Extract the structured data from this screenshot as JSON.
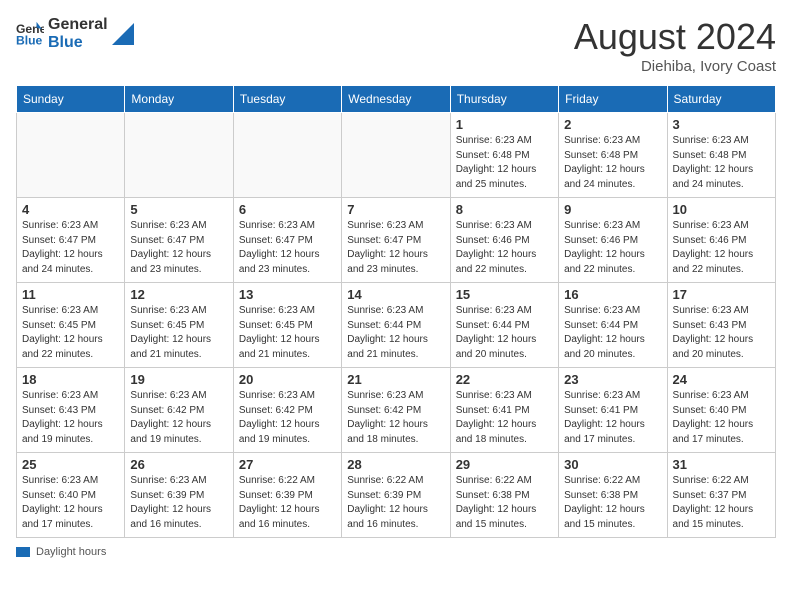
{
  "header": {
    "logo_line1": "General",
    "logo_line2": "Blue",
    "month": "August 2024",
    "location": "Diehiba, Ivory Coast"
  },
  "days_of_week": [
    "Sunday",
    "Monday",
    "Tuesday",
    "Wednesday",
    "Thursday",
    "Friday",
    "Saturday"
  ],
  "weeks": [
    [
      {
        "day": "",
        "info": ""
      },
      {
        "day": "",
        "info": ""
      },
      {
        "day": "",
        "info": ""
      },
      {
        "day": "",
        "info": ""
      },
      {
        "day": "1",
        "info": "Sunrise: 6:23 AM\nSunset: 6:48 PM\nDaylight: 12 hours\nand 25 minutes."
      },
      {
        "day": "2",
        "info": "Sunrise: 6:23 AM\nSunset: 6:48 PM\nDaylight: 12 hours\nand 24 minutes."
      },
      {
        "day": "3",
        "info": "Sunrise: 6:23 AM\nSunset: 6:48 PM\nDaylight: 12 hours\nand 24 minutes."
      }
    ],
    [
      {
        "day": "4",
        "info": "Sunrise: 6:23 AM\nSunset: 6:47 PM\nDaylight: 12 hours\nand 24 minutes."
      },
      {
        "day": "5",
        "info": "Sunrise: 6:23 AM\nSunset: 6:47 PM\nDaylight: 12 hours\nand 23 minutes."
      },
      {
        "day": "6",
        "info": "Sunrise: 6:23 AM\nSunset: 6:47 PM\nDaylight: 12 hours\nand 23 minutes."
      },
      {
        "day": "7",
        "info": "Sunrise: 6:23 AM\nSunset: 6:47 PM\nDaylight: 12 hours\nand 23 minutes."
      },
      {
        "day": "8",
        "info": "Sunrise: 6:23 AM\nSunset: 6:46 PM\nDaylight: 12 hours\nand 22 minutes."
      },
      {
        "day": "9",
        "info": "Sunrise: 6:23 AM\nSunset: 6:46 PM\nDaylight: 12 hours\nand 22 minutes."
      },
      {
        "day": "10",
        "info": "Sunrise: 6:23 AM\nSunset: 6:46 PM\nDaylight: 12 hours\nand 22 minutes."
      }
    ],
    [
      {
        "day": "11",
        "info": "Sunrise: 6:23 AM\nSunset: 6:45 PM\nDaylight: 12 hours\nand 22 minutes."
      },
      {
        "day": "12",
        "info": "Sunrise: 6:23 AM\nSunset: 6:45 PM\nDaylight: 12 hours\nand 21 minutes."
      },
      {
        "day": "13",
        "info": "Sunrise: 6:23 AM\nSunset: 6:45 PM\nDaylight: 12 hours\nand 21 minutes."
      },
      {
        "day": "14",
        "info": "Sunrise: 6:23 AM\nSunset: 6:44 PM\nDaylight: 12 hours\nand 21 minutes."
      },
      {
        "day": "15",
        "info": "Sunrise: 6:23 AM\nSunset: 6:44 PM\nDaylight: 12 hours\nand 20 minutes."
      },
      {
        "day": "16",
        "info": "Sunrise: 6:23 AM\nSunset: 6:44 PM\nDaylight: 12 hours\nand 20 minutes."
      },
      {
        "day": "17",
        "info": "Sunrise: 6:23 AM\nSunset: 6:43 PM\nDaylight: 12 hours\nand 20 minutes."
      }
    ],
    [
      {
        "day": "18",
        "info": "Sunrise: 6:23 AM\nSunset: 6:43 PM\nDaylight: 12 hours\nand 19 minutes."
      },
      {
        "day": "19",
        "info": "Sunrise: 6:23 AM\nSunset: 6:42 PM\nDaylight: 12 hours\nand 19 minutes."
      },
      {
        "day": "20",
        "info": "Sunrise: 6:23 AM\nSunset: 6:42 PM\nDaylight: 12 hours\nand 19 minutes."
      },
      {
        "day": "21",
        "info": "Sunrise: 6:23 AM\nSunset: 6:42 PM\nDaylight: 12 hours\nand 18 minutes."
      },
      {
        "day": "22",
        "info": "Sunrise: 6:23 AM\nSunset: 6:41 PM\nDaylight: 12 hours\nand 18 minutes."
      },
      {
        "day": "23",
        "info": "Sunrise: 6:23 AM\nSunset: 6:41 PM\nDaylight: 12 hours\nand 17 minutes."
      },
      {
        "day": "24",
        "info": "Sunrise: 6:23 AM\nSunset: 6:40 PM\nDaylight: 12 hours\nand 17 minutes."
      }
    ],
    [
      {
        "day": "25",
        "info": "Sunrise: 6:23 AM\nSunset: 6:40 PM\nDaylight: 12 hours\nand 17 minutes."
      },
      {
        "day": "26",
        "info": "Sunrise: 6:23 AM\nSunset: 6:39 PM\nDaylight: 12 hours\nand 16 minutes."
      },
      {
        "day": "27",
        "info": "Sunrise: 6:22 AM\nSunset: 6:39 PM\nDaylight: 12 hours\nand 16 minutes."
      },
      {
        "day": "28",
        "info": "Sunrise: 6:22 AM\nSunset: 6:39 PM\nDaylight: 12 hours\nand 16 minutes."
      },
      {
        "day": "29",
        "info": "Sunrise: 6:22 AM\nSunset: 6:38 PM\nDaylight: 12 hours\nand 15 minutes."
      },
      {
        "day": "30",
        "info": "Sunrise: 6:22 AM\nSunset: 6:38 PM\nDaylight: 12 hours\nand 15 minutes."
      },
      {
        "day": "31",
        "info": "Sunrise: 6:22 AM\nSunset: 6:37 PM\nDaylight: 12 hours\nand 15 minutes."
      }
    ]
  ],
  "footer": {
    "daylight_label": "Daylight hours"
  }
}
